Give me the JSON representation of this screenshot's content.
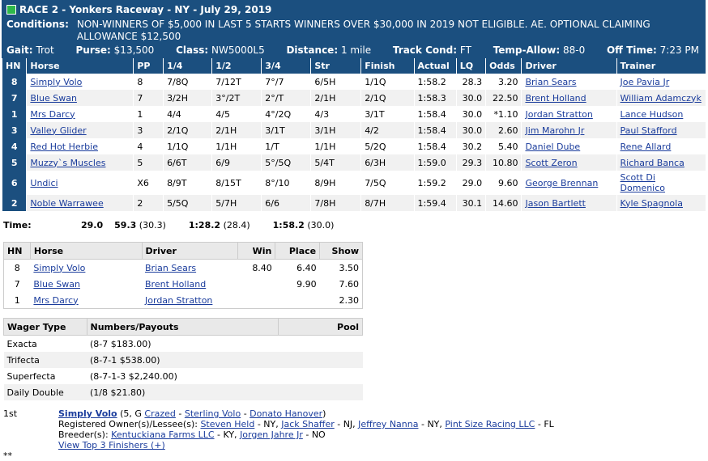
{
  "header": {
    "title": "RACE 2 - Yonkers Raceway - NY - July 29, 2019",
    "conditions_label": "Conditions:",
    "conditions_text": "NON-WINNERS OF $5,000 IN LAST 5 STARTS WINNERS OVER $30,000 IN 2019 NOT ELIGIBLE. AE. OPTIONAL CLAIMING ALLOWANCE $12,500",
    "gait_label": "Gait:",
    "gait": "Trot",
    "purse_label": "Purse:",
    "purse": "$13,500",
    "class_label": "Class:",
    "class": "NW5000L5",
    "distance_label": "Distance:",
    "distance": "1 mile",
    "track_label": "Track Cond:",
    "track": "FT",
    "temp_label": "Temp-Allow:",
    "temp": "88-0",
    "off_label": "Off Time:",
    "off": "7:23 PM"
  },
  "results": {
    "columns": [
      "HN",
      "Horse",
      "PP",
      "1/4",
      "1/2",
      "3/4",
      "Str",
      "Finish",
      "Actual",
      "LQ",
      "Odds",
      "Driver",
      "Trainer"
    ],
    "rows": [
      {
        "hn": "8",
        "horse": "Simply Volo",
        "pp": "8",
        "q1": "7/8Q",
        "q2": "7/12T",
        "q3": "7°/7",
        "str": "6/5H",
        "fin": "1/1Q",
        "actual": "1:58.2",
        "lq": "28.3",
        "odds": "3.20",
        "driver": "Brian Sears",
        "trainer": "Joe Pavia Jr"
      },
      {
        "hn": "7",
        "horse": "Blue Swan",
        "pp": "7",
        "q1": "3/2H",
        "q2": "3°/2T",
        "q3": "2°/T",
        "str": "2/1H",
        "fin": "2/1Q",
        "actual": "1:58.3",
        "lq": "30.0",
        "odds": "22.50",
        "driver": "Brent Holland",
        "trainer": "William Adamczyk"
      },
      {
        "hn": "1",
        "horse": "Mrs Darcy",
        "pp": "1",
        "q1": "4/4",
        "q2": "4/5",
        "q3": "4°/2Q",
        "str": "4/3",
        "fin": "3/1T",
        "actual": "1:58.4",
        "lq": "30.0",
        "odds": "*1.10",
        "driver": "Jordan Stratton",
        "trainer": "Lance Hudson"
      },
      {
        "hn": "3",
        "horse": "Valley Glider",
        "pp": "3",
        "q1": "2/1Q",
        "q2": "2/1H",
        "q3": "3/1T",
        "str": "3/1H",
        "fin": "4/2",
        "actual": "1:58.4",
        "lq": "30.0",
        "odds": "2.60",
        "driver": "Jim Marohn Jr",
        "trainer": "Paul Stafford"
      },
      {
        "hn": "4",
        "horse": "Red Hot Herbie",
        "pp": "4",
        "q1": "1/1Q",
        "q2": "1/1H",
        "q3": "1/T",
        "str": "1/1H",
        "fin": "5/2Q",
        "actual": "1:58.4",
        "lq": "30.2",
        "odds": "5.40",
        "driver": "Daniel Dube",
        "trainer": "Rene Allard"
      },
      {
        "hn": "5",
        "horse": "Muzzy`s Muscles",
        "pp": "5",
        "q1": "6/6T",
        "q2": "6/9",
        "q3": "5°/5Q",
        "str": "5/4T",
        "fin": "6/3H",
        "actual": "1:59.0",
        "lq": "29.3",
        "odds": "10.80",
        "driver": "Scott Zeron",
        "trainer": "Richard Banca"
      },
      {
        "hn": "6",
        "horse": "Undici",
        "pp": "X6",
        "q1": "8/9T",
        "q2": "8/15T",
        "q3": "8°/10",
        "str": "8/9H",
        "fin": "7/5Q",
        "actual": "1:59.2",
        "lq": "29.0",
        "odds": "9.60",
        "driver": "George Brennan",
        "trainer": "Scott Di Domenico"
      },
      {
        "hn": "2",
        "horse": "Noble Warrawee",
        "pp": "2",
        "q1": "5/5Q",
        "q2": "5/7H",
        "q3": "6/6",
        "str": "7/8H",
        "fin": "8/7H",
        "actual": "1:59.4",
        "lq": "30.1",
        "odds": "14.60",
        "driver": "Jason Bartlett",
        "trainer": "Kyle Spagnola"
      }
    ]
  },
  "times": {
    "label": "Time:",
    "t1": "29.0",
    "t2": "59.3",
    "t2s": "(30.3)",
    "t3": "1:28.2",
    "t3s": "(28.4)",
    "t4": "1:58.2",
    "t4s": "(30.0)"
  },
  "payouts": {
    "columns": [
      "HN",
      "Horse",
      "Driver",
      "Win",
      "Place",
      "Show"
    ],
    "rows": [
      {
        "hn": "8",
        "horse": "Simply Volo",
        "driver": "Brian Sears",
        "win": "8.40",
        "place": "6.40",
        "show": "3.50"
      },
      {
        "hn": "7",
        "horse": "Blue Swan",
        "driver": "Brent Holland",
        "win": "",
        "place": "9.90",
        "show": "7.60"
      },
      {
        "hn": "1",
        "horse": "Mrs Darcy",
        "driver": "Jordan Stratton",
        "win": "",
        "place": "",
        "show": "2.30"
      }
    ]
  },
  "wagers": {
    "columns": [
      "Wager Type",
      "Numbers/Payouts",
      "Pool"
    ],
    "rows": [
      {
        "type": "Exacta",
        "payout": "(8-7 $183.00)",
        "pool": ""
      },
      {
        "type": "Trifecta",
        "payout": "(8-7-1 $538.00)",
        "pool": ""
      },
      {
        "type": "Superfecta",
        "payout": "(8-7-1-3 $2,240.00)",
        "pool": ""
      },
      {
        "type": "Daily Double",
        "payout": "(1/8 $21.80)",
        "pool": ""
      }
    ]
  },
  "footer": {
    "place": "1st",
    "winner": "Simply Volo",
    "winner_info": "(5, G",
    "sire": "Crazed",
    "dam": "Sterling Volo",
    "damsire": "Donato Hanover",
    "close": ")",
    "owners_label": "Registered Owner(s)/Lessee(s):",
    "owners": [
      {
        "name": "Steven Held",
        "loc": "- NY,"
      },
      {
        "name": "Jack Shaffer",
        "loc": "- NJ,"
      },
      {
        "name": "Jeffrey Nanna",
        "loc": "- NY,"
      },
      {
        "name": "Pint Size Racing LLC",
        "loc": "- FL"
      }
    ],
    "breeders_label": "Breeder(s):",
    "breeders": [
      {
        "name": "Kentuckiana Farms LLC",
        "loc": "- KY,"
      },
      {
        "name": "Jorgen Jahre Jr",
        "loc": "- NO"
      }
    ],
    "stars": "**",
    "view_top": "View Top 3 Finishers (+)"
  }
}
